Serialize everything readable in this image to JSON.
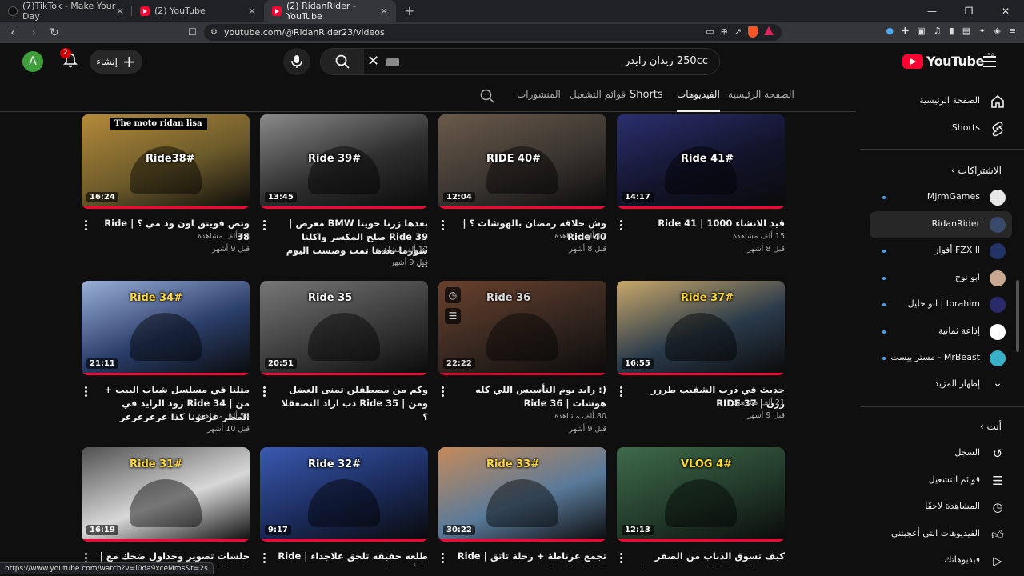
{
  "browser": {
    "tabs": [
      {
        "title": "(7)TikTok - Make Your Day",
        "active": false
      },
      {
        "title": "(2) YouTube",
        "active": false
      },
      {
        "title": "(2) RidanRider - YouTube",
        "active": true
      }
    ],
    "url": "youtube.com/@RidanRider23/videos",
    "status_url": "https://www.youtube.com/watch?v=l0da9xceMms&t=2s"
  },
  "header": {
    "avatar_letter": "A",
    "notification_count": "2",
    "create_label": "إنشاء",
    "search_query": "250cc ريدان رايدر",
    "logo_word": "YouTube",
    "logo_region": "SA"
  },
  "channel_tabs": {
    "home": "الصفحة الرئيسية",
    "videos": "الفيديوهات",
    "shorts": "Shorts",
    "playlists": "قوائم التشغيل",
    "posts": "المنشورات"
  },
  "videos": [
    {
      "title": "قيد الانشاء 1000 | Ride 41",
      "views": "15 ألف مشاهدة",
      "age": "قبل 8 أشهر",
      "duration": "14:17",
      "thumb_text": "Ride 41#",
      "bg": "#12142b",
      "accent": "#2b2f6e"
    },
    {
      "title": "وش حلاقه رمضان بالهوشات ؟ | Ride 40",
      "views": "17 ألف مشاهدة",
      "age": "قبل 8 أشهر",
      "duration": "12:04",
      "thumb_text": "RIDE 40#",
      "bg": "#3a3530",
      "accent": "#6a5a4a"
    },
    {
      "title": "بعدها زرنا خويتا BMW معرض | Ride 39 صلح المكسر واكلنا شورما بعدها تمت وصست اليوم ...",
      "views": "17 ألف مشاهدة",
      "age": "قبل 9 أشهر",
      "duration": "13:45",
      "thumb_text": "Ride 39#",
      "bg": "#2e2e2e",
      "accent": "#8a8a8a"
    },
    {
      "title": "وتص فويتق اون وذ مي ؟ | Ride 38",
      "views": "18 ألف مشاهدة",
      "age": "قبل 9 أشهر",
      "duration": "16:24",
      "thumb_text": "Ride38#",
      "top_text": "The moto ridan lisa",
      "bg": "#6b5a2a",
      "accent": "#b58a3a"
    },
    {
      "title": "حديث في درب الشفيب طررر ررن | RIDE 37",
      "views": "21 ألف مشاهدة",
      "age": "قبل 9 أشهر",
      "duration": "16:55",
      "thumb_text": "Ride 37#",
      "bg": "#2a3a4a",
      "accent": "#c9a86a"
    },
    {
      "title": "(: رايد يوم التأسيس اللي كله هوشات | Ride 36",
      "views": "80 ألف مشاهدة",
      "age": "قبل 9 أشهر",
      "duration": "22:22",
      "thumb_text": "Ride 36",
      "bg": "#3a2a22",
      "accent": "#7a4a32"
    },
    {
      "title": "وكم من مصطفلن تمنى العضل ومن | Ride 35 دب اراد التصعقلا ؟",
      "views": "",
      "age": "",
      "duration": "20:51",
      "thumb_text": "Ride 35",
      "bg": "#3a3a3a",
      "accent": "#777777"
    },
    {
      "title": "مثلنا في مسلسل شباب البيب + من | Ride 34 زود الرايد في المطر عرعونا كذا عرعرعرعر",
      "views": "54 ألف مشاهدة",
      "age": "قبل 10 أشهر",
      "duration": "21:11",
      "thumb_text": "Ride 34#",
      "bg": "#2a3e6a",
      "accent": "#9ab0d8"
    },
    {
      "title": "كيف تسوق الدباب من الصفر خمسه | VLOG 4 خمس لاصدق ( تعليم قياده الدباب )",
      "views": "",
      "age": "",
      "duration": "12:13",
      "thumb_text": "VLOG 4#",
      "bg": "#223a2a",
      "accent": "#3e6a4a"
    },
    {
      "title": "تجمع عرناطة + رحلة تاتق | Ride 33 البو لستيكية",
      "views": "",
      "age": "",
      "duration": "30:22",
      "thumb_text": "Ride 33#",
      "bg": "#5a7a9a",
      "accent": "#c48a5a"
    },
    {
      "title": "طلعه خفيفه تلحق علاجداء | Ride 32",
      "views": "17 ألف مشاهدة",
      "age": "قبل 10 أشهر",
      "duration": "9:17",
      "thumb_text": "Ride 32#",
      "bg": "#1a2a5a",
      "accent": "#3a5ab0"
    },
    {
      "title": "جلسات تصوير وجداول ضحك مع | Ride 31 الشباب",
      "views": "",
      "age": "",
      "duration": "16:19",
      "thumb_text": "Ride 31#",
      "bg": "#d8d8d8",
      "accent": "#505050"
    }
  ],
  "sidebar": {
    "home": "الصفحة الرئيسية",
    "shorts": "Shorts",
    "subscriptions_head": "الاشتراكات",
    "subscriptions": [
      {
        "name": "MjrmGames",
        "color": "#e8e8e8",
        "dot": true
      },
      {
        "name": "RidanRider",
        "color": "#3a4a6a",
        "dot": false,
        "active": true
      },
      {
        "name": "FZX ll أفواز",
        "color": "#223366",
        "dot": true
      },
      {
        "name": "ابو نوح",
        "color": "#c8a890",
        "dot": true
      },
      {
        "name": "Ibrahim | ابو خليل",
        "color": "#2a2a6a",
        "dot": true
      },
      {
        "name": "إذاعة ثمانية",
        "color": "#ffffff",
        "dot": true
      },
      {
        "name": "MrBeast - مستر بيست",
        "color": "#3ab0c8",
        "dot": true
      }
    ],
    "show_more": "إظهار المزيد",
    "you_head": "أنت",
    "you_items": [
      "السجل",
      "قوائم التشغيل",
      "المشاهدة لاحقًا",
      "الفيديوهات التي أعجبتني",
      "فيديوهاتك"
    ]
  }
}
